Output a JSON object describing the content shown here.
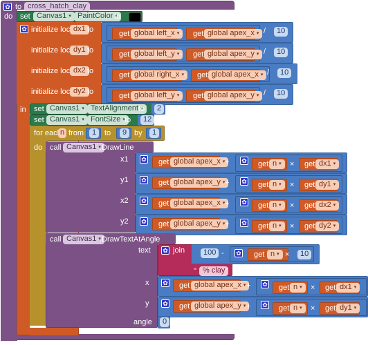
{
  "procedure": {
    "keyword_to": "to",
    "name": "cross_hatch_clay",
    "keyword_do": "do"
  },
  "set_paint": {
    "kw_set": "set",
    "component": "Canvas1",
    "dot": ".",
    "property": "PaintColor",
    "kw_to": "to",
    "color": "#000000"
  },
  "locals": {
    "kw_init": "initialize local",
    "kw_to": "to",
    "kw_in": "in",
    "items": [
      {
        "name": "dx1",
        "a": "global left_x",
        "b": "global apex_x",
        "minus": "-",
        "div": "/",
        "divisor": "10"
      },
      {
        "name": "dy1",
        "a": "global left_y",
        "b": "global apex_y",
        "minus": "-",
        "div": "/",
        "divisor": "10"
      },
      {
        "name": "dx2",
        "a": "global right_x",
        "b": "global apex_x",
        "minus": "-",
        "div": "/",
        "divisor": "10"
      },
      {
        "name": "dy2",
        "a": "global left_y",
        "b": "global apex_y",
        "minus": "-",
        "div": "/",
        "divisor": "10"
      }
    ]
  },
  "set_align": {
    "kw_set": "set",
    "component": "Canvas1",
    "dot": ".",
    "property": "TextAlignment",
    "kw_to": "to",
    "value": "2"
  },
  "set_font": {
    "kw_set": "set",
    "component": "Canvas1",
    "dot": ".",
    "property": "FontSize",
    "kw_to": "to",
    "value": "12"
  },
  "loop": {
    "kw_for": "for each",
    "var": "n",
    "kw_from": "from",
    "from": "1",
    "kw_to": "to",
    "to": "9",
    "kw_by": "by",
    "by": "1",
    "kw_do": "do"
  },
  "get": "get",
  "plus": "+",
  "times": "×",
  "drawline": {
    "kw_call": "call",
    "component": "Canvas1",
    "method": ".DrawLine",
    "args": [
      {
        "label": "x1",
        "base": "global apex_x",
        "n": "n",
        "d": "dx1"
      },
      {
        "label": "y1",
        "base": "global apex_y",
        "n": "n",
        "d": "dy1"
      },
      {
        "label": "x2",
        "base": "global apex_x",
        "n": "n",
        "d": "dx2"
      },
      {
        "label": "y2",
        "base": "global apex_y",
        "n": "n",
        "d": "dy2"
      }
    ]
  },
  "drawtext": {
    "kw_call": "call",
    "component": "Canvas1",
    "method": ".DrawTextAtAngle",
    "text_label": "text",
    "join": "join",
    "hundred": "100",
    "minus": "-",
    "n": "n",
    "ten": "10",
    "quote": "\"",
    "suffix": "% clay",
    "x_label": "x",
    "x_base": "global apex_x",
    "x_n": "n",
    "x_d": "dx1",
    "y_label": "y",
    "y_base": "global apex_y",
    "y_n": "n",
    "y_d": "dy1",
    "angle_label": "angle",
    "angle": "0"
  }
}
